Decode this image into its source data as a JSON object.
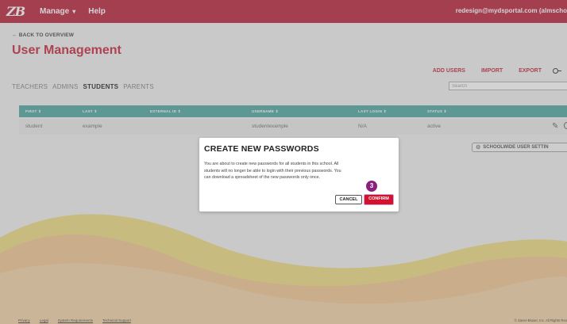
{
  "topbar": {
    "logo": "ZB",
    "nav": [
      {
        "label": "Manage",
        "caret": "▾"
      },
      {
        "label": "Help"
      }
    ],
    "user_email": "redesign@mydsportal.com (almscho"
  },
  "header": {
    "back_link": "← BACK TO OVERVIEW",
    "title": "User Management",
    "actions": [
      "ADD USERS",
      "IMPORT",
      "EXPORT"
    ],
    "key_icon": "key-icon"
  },
  "tabs": [
    {
      "label": "TEACHERS",
      "active": false
    },
    {
      "label": "ADMINS",
      "active": false
    },
    {
      "label": "STUDENTS",
      "active": true
    },
    {
      "label": "PARENTS",
      "active": false
    }
  ],
  "search": {
    "placeholder": "Search"
  },
  "table": {
    "columns": [
      "FIRST ⇕",
      "LAST ⇕",
      "EXTERNAL ID ⇕",
      "USERNAME ⇕",
      "LAST LOGIN ⇕",
      "STATUS ⇕"
    ],
    "rows": [
      {
        "first": "student",
        "last": "example",
        "external_id": "",
        "username": "studentexample",
        "last_login": "N/A",
        "status": "active"
      }
    ],
    "header_color": "#41a199"
  },
  "settings_button": {
    "label": "SCHOOLWIDE USER SETTIN",
    "icon": "gear-icon"
  },
  "modal": {
    "title": "CREATE NEW PASSWORDS",
    "body_lines": [
      "You are about to create new passwords for all students in this school. All",
      "students will no longer be able to login with their previous passwords. You",
      "can download a spreadsheet of the new passwords only once."
    ],
    "step_badge": "3",
    "cancel_label": "CANCEL",
    "confirm_label": "CONFIRM"
  },
  "footer": {
    "links": [
      "Privacy",
      "Legal",
      "System Requirements",
      "Technical Support"
    ],
    "copyright": "© Zaner-Bloser, Inc. All Rights Res"
  },
  "colors": {
    "brand_red": "#b3112b",
    "accent_red": "#c0152f",
    "teal": "#41a199",
    "badge_purple": "#8a1f7e"
  }
}
